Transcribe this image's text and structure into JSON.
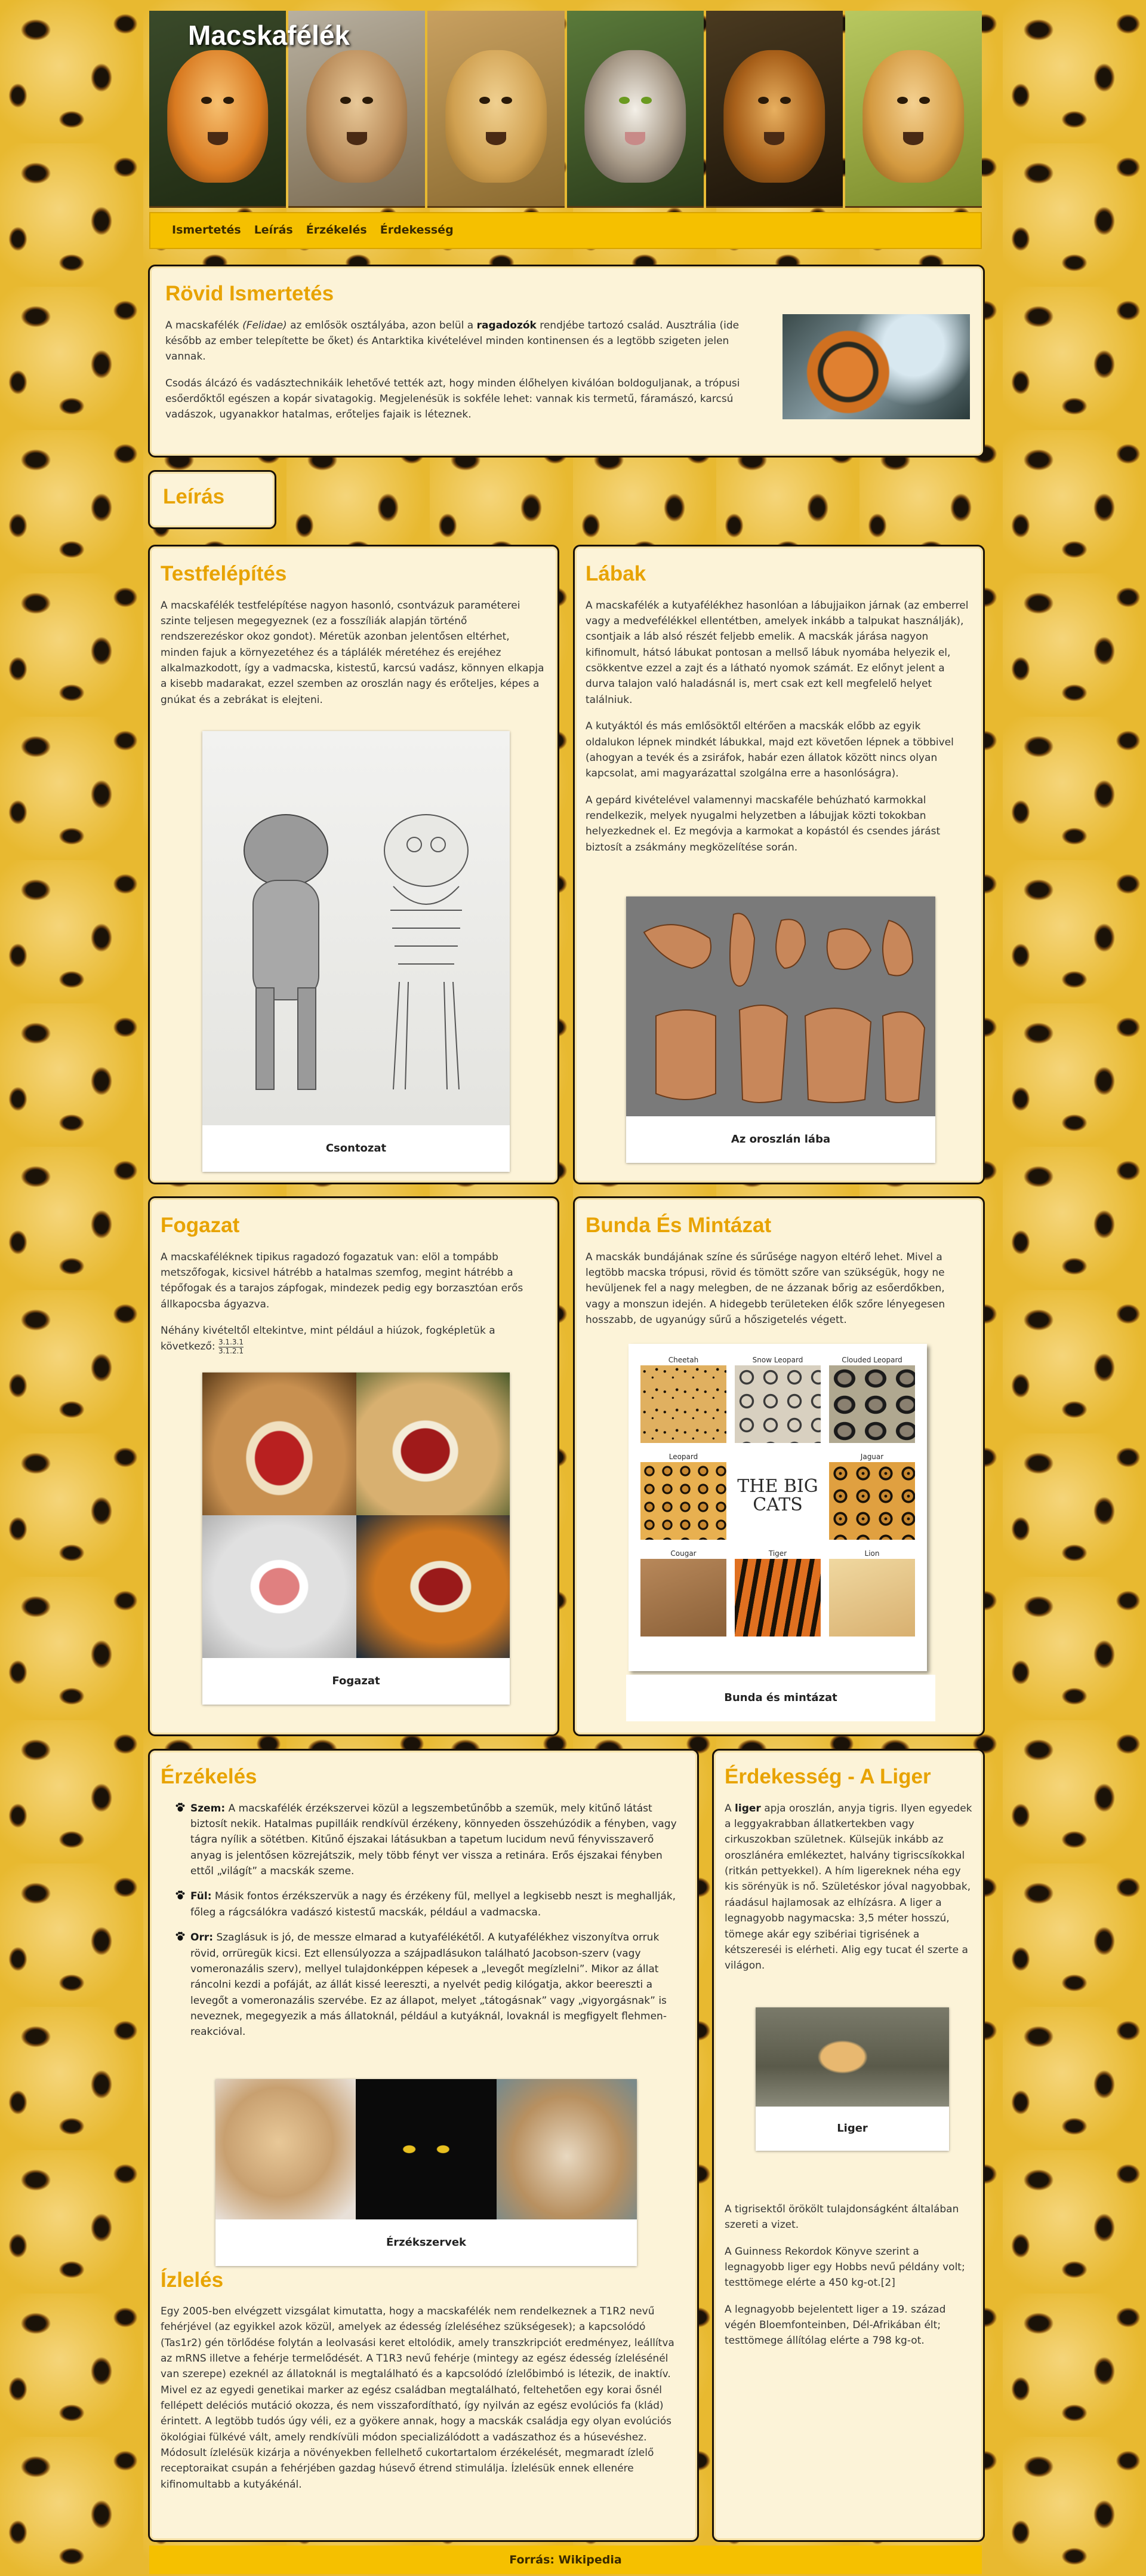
{
  "site": {
    "title": "Macskafélék"
  },
  "nav": [
    "Ismertetés",
    "Leírás",
    "Érzékelés",
    "Érdekesség"
  ],
  "intro": {
    "title": "Rövid Ismertetés",
    "p1_a": "A macskafélék",
    "p1_i": "(Felidae)",
    "p1_b": "az emlősök osztályába, azon belül a",
    "p1_bold": "ragadozók",
    "p1_c": "rendjébe tartozó család. Ausztrália (ide később az ember telepítette be őket) és Antarktika kivételével minden kontinensen és a legtöbb szigeten jelen vannak.",
    "p2": "Csodás álcázó és vadásztechnikáik lehetővé tették azt, hogy minden élőhelyen kiválóan boldoguljanak, a trópusi esőerdőktől egészen a kopár sivatagokig. Megjelenésük is sokféle lehet: vannak kis termetű, fáramászó, karcsú vadászok, ugyanakkor hatalmas, erőteljes fajaik is léteznek."
  },
  "leiras": {
    "title": "Leírás"
  },
  "testfelepites": {
    "title": "Testfelépítés",
    "p1": "A macskafélék testfelépítése nagyon hasonló, csontvázuk paraméterei szinte teljesen megegyeznek (ez a fosszíliák alapján történő rendszerezéskor okoz gondot). Méretük azonban jelentősen eltérhet, minden fajuk a környezetéhez és a táplálék méretéhez és erejéhez alkalmazkodott, így a vadmacska, kistestű, karcsú vadász, könnyen elkapja a kisebb madarakat, ezzel szemben az oroszlán nagy és erőteljes, képes a gnúkat és a zebrákat is elejteni.",
    "caption": "Csontozat"
  },
  "labak": {
    "title": "Lábak",
    "p1": "A macskafélék a kutyafélékhez hasonlóan a lábujjaikon járnak (az emberrel vagy a medvefélékkel ellentétben, amelyek inkább a talpukat használják), csontjaik a láb alsó részét feljebb emelik. A macskák járása nagyon kifinomult, hátsó lábukat pontosan a mellső lábuk nyomába helyezik el, csökkentve ezzel a zajt és a látható nyomok számát. Ez előnyt jelent a durva talajon való haladásnál is, mert csak ezt kell megfelelő helyet találniuk.",
    "p2": "A kutyáktól és más emlősöktől eltérően a macskák előbb az egyik oldalukon lépnek mindkét lábukkal, majd ezt követően lépnek a többivel (ahogyan a tevék és a zsiráfok, habár ezen állatok között nincs olyan kapcsolat, ami magyarázattal szolgálna erre a hasonlóságra).",
    "p3": "A gepárd kivételével valamennyi macskaféle behúzható karmokkal rendelkezik, melyek nyugalmi helyzetben a lábujjak közti tokokban helyezkednek el. Ez megóvja a karmokat a kopástól és csendes járást biztosít a zsákmány megközelítése során.",
    "caption": "Az oroszlán lába"
  },
  "fogazat": {
    "title": "Fogazat",
    "p1": "A macskaféléknek tipikus ragadozó fogazatuk van: elöl a tompább metszőfogak, kicsivel hátrébb a hatalmas szemfog, megint hátrébb a tépőfogak és a tarajos zápfogak, mindezek pedig egy borzasztóan erős állkapocsba ágyazva.",
    "p2": "Néhány kivételtől eltekintve, mint például a hiúzok, fogképletük a következő:",
    "formula_top": "3.1.3.1",
    "formula_bot": "3.1.2.1",
    "caption": "Fogazat"
  },
  "bunda": {
    "title": "Bunda És Mintázat",
    "p1": "A macskák bundájának színe és sűrűsége nagyon eltérő lehet. Mivel a legtöbb macska trópusi, rövid és tömött szőre van szükségük, hogy ne hevüljenek fel a nagy melegben, de ne ázzanak bőrig az esőerdőkben, vagy a monszun idején. A hidegebb területeken élők szőre lényegesen hosszabb, de ugyanúgy sűrű a hőszigetelés végett.",
    "chart_labels": [
      "Cheetah",
      "Snow Leopard",
      "Clouded Leopard",
      "Leopard",
      "Jaguar",
      "Cougar",
      "Tiger",
      "Lion"
    ],
    "center_line1": "THE BIG",
    "center_line2": "CATS",
    "caption": "Bunda és mintázat"
  },
  "erzekeles": {
    "title": "Érzékelés",
    "items": [
      {
        "label": "Szem:",
        "text": "A macskafélék érzékszervei közül a legszembetűnőbb a szemük, mely kitűnő látást biztosít nekik. Hatalmas pupilláik rendkívül érzékeny, könnyeden összehúzódik a fényben, vagy tágra nyílik a sötétben. Kitűnő éjszakai látásukban a tapetum lucidum nevű fényvisszaverő anyag is jelentősen közrejátszik, mely több fényt ver vissza a retinára. Erős éjszakai fényben ettől „világít” a macskák szeme."
      },
      {
        "label": "Fül:",
        "text": "Másik fontos érzékszervük a nagy és érzékeny fül, mellyel a legkisebb neszt is meghallják, főleg a rágcsálókra vadászó kistestű macskák, például a vadmacska."
      },
      {
        "label": "Orr:",
        "text": "Szaglásuk is jó, de messze elmarad a kutyafélékétől. A kutyafélékhez viszonyítva orruk rövid, orrüregük kicsi. Ezt ellensúlyozza a szájpadlásukon található Jacobson-szerv (vagy vomeronazális szerv), mellyel tulajdonképpen képesek a „levegőt megízlelni”. Mikor az állat ráncolni kezdi a pofáját, az állát kissé leereszti, a nyelvét pedig kilógatja, akkor beereszti a levegőt a vomeronazális szervébe. Ez az állapot, melyet „tátogásnak” vagy „vigyorgásnak” is neveznek, megegyezik a más állatoknál, például a kutyáknál, lovaknál is megfigyelt flehmen-reakcióval."
      }
    ],
    "caption": "Érzékszervek"
  },
  "izleles": {
    "title": "Ízlelés",
    "p1": "Egy 2005-ben elvégzett vizsgálat kimutatta, hogy a macskafélék nem rendelkeznek a T1R2 nevű fehérjével (az egyikkel azok közül, amelyek az édesség ízleléséhez szükségesek); a kapcsolódó (Tas1r2) gén törlődése folytán a leolvasási keret eltolódik, amely transzkripciót eredményez, leállítva az mRNS illetve a fehérje termelődését. A T1R3 nevű fehérje (mintegy az egész édesség ízlelésénél van szerepe) ezeknél az állatoknál is megtalálható és a kapcsolódó ízlelőbimbó is létezik, de inaktív. Mivel ez az egyedi genetikai marker az egész családban megtalálható, feltehetően egy korai ősnél fellépett deléciós mutáció okozza, és nem visszafordítható, így nyilván az egész evolúciós fa (klád) érintett. A legtöbb tudós úgy véli, ez a gyökere annak, hogy a macskák családja egy olyan evolúciós ökológiai fülkévé vált, amely rendkívüli módon specializálódott a vadászathoz és a húsevéshez. Módosult ízlelésük kizárja a növényekben fellelhető cukortartalom érzékelését, megmaradt ízlelő receptoraikat csupán a fehérjében gazdag húsevő étrend stimulálja. Ízlelésük ennek ellenére kifinomultabb a kutyákénál."
  },
  "liger": {
    "title": "Érdekesség - A Liger",
    "p1_a": "A",
    "p1_bold": "liger",
    "p1_b": "apja oroszlán, anyja tigris. Ilyen egyedek a leggyakrabban állatkertekben vagy cirkuszokban születnek. Külsejük inkább az oroszlánéra emlékeztet, halvány tigriscsíkokkal (ritkán pettyekkel). A hím ligereknek néha egy kis sörényük is nő. Születéskor jóval nagyobbak, ráadásul hajlamosak az elhízásra. A liger a legnagyobb nagymacska: 3,5 méter hosszú, tömege akár egy szibériai tigrisének a kétszereséi is elérheti. Alig egy tucat él szerte a világon.",
    "caption": "Liger",
    "p2": "A tigrisektől örökölt tulajdonságként általában szereti a vizet.",
    "p3": "A Guinness Rekordok Könyve szerint a legnagyobb liger egy Hobbs nevű példány volt; testtömege elérte a 450 kg-ot.[2]",
    "p4": "A legnagyobb bejelentett liger a 19. század végén Bloemfonteinben, Dél-Afrikában élt; testtömege állítólag elérte a 798 kg-ot."
  },
  "footer": {
    "text": "Forrás: Wikipedia"
  },
  "colors": {
    "accent": "#e8a300",
    "nav": "#f5c000",
    "panel": "#fcf3d8"
  }
}
